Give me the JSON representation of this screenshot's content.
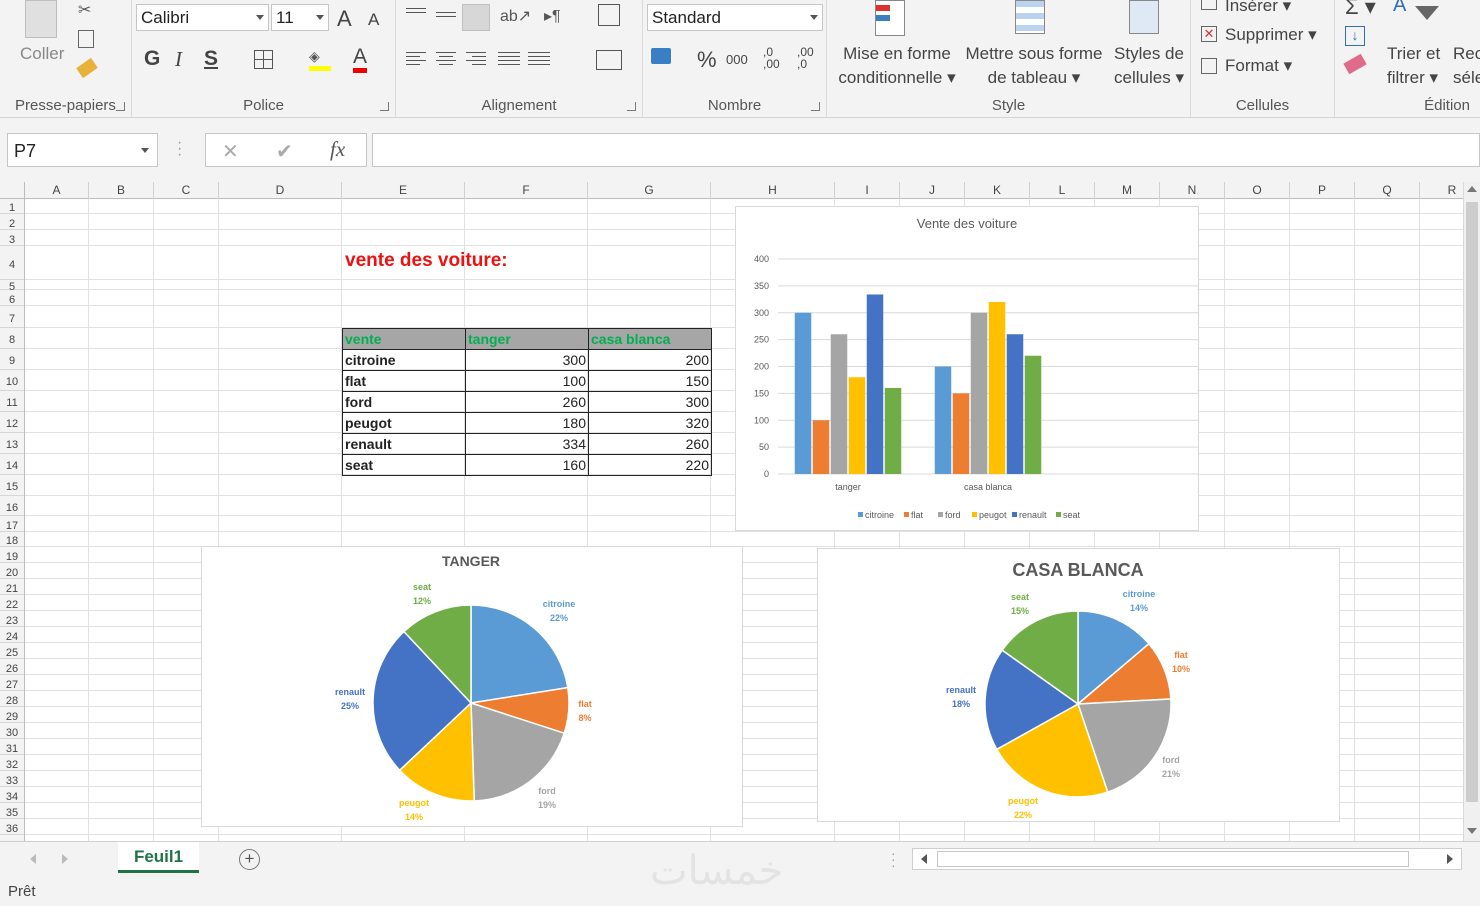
{
  "ribbon": {
    "clipboard": {
      "paste_label": "Coller",
      "group_label": "Presse-papiers"
    },
    "font": {
      "name": "Calibri",
      "size": "11",
      "bold": "G",
      "italic": "I",
      "underline": "S",
      "grow": "A",
      "shrink": "A",
      "font_color_letter": "A",
      "group_label": "Police"
    },
    "alignment": {
      "group_label": "Alignement"
    },
    "number": {
      "format": "Standard",
      "percent": "%",
      "thousands": "000",
      "inc_decimal": ",0 ,00",
      "dec_decimal": ",00 ,0",
      "group_label": "Nombre"
    },
    "style": {
      "conditional_line1": "Mise en forme",
      "conditional_line2": "conditionnelle",
      "table_line1": "Mettre sous forme",
      "table_line2": "de tableau",
      "cell_styles_line1": "Styles de",
      "cell_styles_line2": "cellules",
      "group_label": "Style"
    },
    "cells": {
      "insert": "Insérer",
      "delete": "Supprimer",
      "format": "Format",
      "group_label": "Cellules"
    },
    "editing": {
      "sort_line1": "Trier et",
      "sort_line2": "filtrer",
      "find_line1": "Rech",
      "find_line2": "séle",
      "group_label": "Édition"
    }
  },
  "formula_bar": {
    "name_box": "P7",
    "cancel": "✕",
    "enter": "✔",
    "fx": "fx",
    "formula": ""
  },
  "columns": [
    "A",
    "B",
    "C",
    "D",
    "E",
    "F",
    "G",
    "H",
    "I",
    "J",
    "K",
    "L",
    "M",
    "N",
    "O",
    "P",
    "Q",
    "R"
  ],
  "rows": [
    "1",
    "2",
    "3",
    "4",
    "5",
    "6",
    "7",
    "8",
    "9",
    "10",
    "11",
    "12",
    "13",
    "14",
    "15",
    "16",
    "17",
    "18",
    "19",
    "20",
    "21",
    "22",
    "23",
    "24",
    "25",
    "26",
    "27",
    "28",
    "29",
    "30",
    "31",
    "32",
    "33",
    "34",
    "35",
    "36"
  ],
  "sheet": {
    "title": "vente des voiture:",
    "table": {
      "headers": [
        "vente",
        "tanger",
        "casa blanca"
      ],
      "rows": [
        [
          "citroine",
          "300",
          "200"
        ],
        [
          "flat",
          "100",
          "150"
        ],
        [
          "ford",
          "260",
          "300"
        ],
        [
          "peugot",
          "180",
          "320"
        ],
        [
          "renault",
          "334",
          "260"
        ],
        [
          "seat",
          "160",
          "220"
        ]
      ]
    }
  },
  "chart_data": [
    {
      "type": "bar",
      "title": "Vente des voiture",
      "categories": [
        "tanger",
        "casa blanca"
      ],
      "series": [
        {
          "name": "citroine",
          "values": [
            300,
            200
          ],
          "color": "#5b9bd5"
        },
        {
          "name": "flat",
          "values": [
            100,
            150
          ],
          "color": "#ed7d31"
        },
        {
          "name": "ford",
          "values": [
            260,
            300
          ],
          "color": "#a5a5a5"
        },
        {
          "name": "peugot",
          "values": [
            180,
            320
          ],
          "color": "#ffc000"
        },
        {
          "name": "renault",
          "values": [
            334,
            260
          ],
          "color": "#4472c4"
        },
        {
          "name": "seat",
          "values": [
            160,
            220
          ],
          "color": "#70ad47"
        }
      ],
      "ylim": [
        0,
        400
      ],
      "yticks": [
        "0",
        "50",
        "100",
        "150",
        "200",
        "250",
        "300",
        "350",
        "400"
      ],
      "grid": true,
      "legend": "bottom"
    },
    {
      "type": "pie",
      "title": "TANGER",
      "labels": [
        "citroine",
        "flat",
        "ford",
        "peugot",
        "renault",
        "seat"
      ],
      "values": [
        300,
        100,
        260,
        180,
        334,
        160
      ],
      "percents": [
        "22%",
        "8%",
        "19%",
        "14%",
        "25%",
        "12%"
      ],
      "colors": [
        "#5b9bd5",
        "#ed7d31",
        "#a5a5a5",
        "#ffc000",
        "#4472c4",
        "#70ad47"
      ]
    },
    {
      "type": "pie",
      "title": "CASA BLANCA",
      "labels": [
        "citroine",
        "flat",
        "ford",
        "peugot",
        "renault",
        "seat"
      ],
      "values": [
        200,
        150,
        300,
        320,
        260,
        220
      ],
      "percents": [
        "14%",
        "10%",
        "21%",
        "22%",
        "18%",
        "15%"
      ],
      "colors": [
        "#5b9bd5",
        "#ed7d31",
        "#a5a5a5",
        "#ffc000",
        "#4472c4",
        "#70ad47"
      ]
    }
  ],
  "tabs": {
    "sheet_name": "Feuil1",
    "add": "+"
  },
  "status": {
    "text": "Prêt"
  },
  "watermark": "خمسات"
}
